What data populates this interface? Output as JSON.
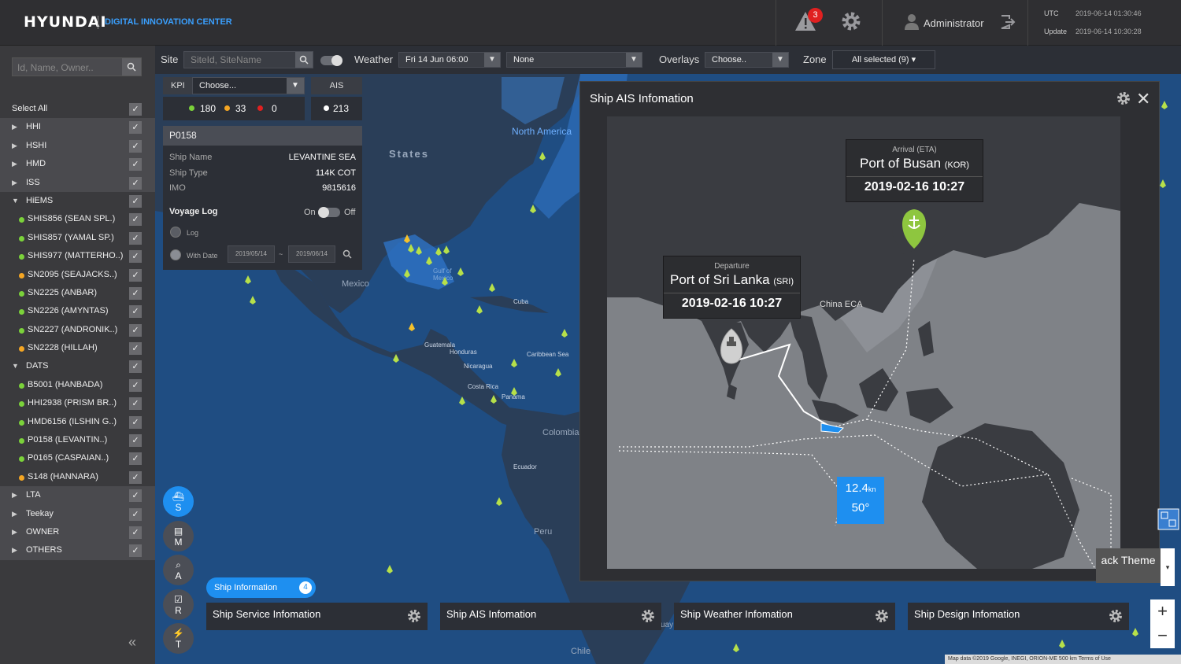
{
  "header": {
    "brand": "HYUNDAI",
    "subtitle": "DIGITAL INNOVATION CENTER",
    "alert_count": "3",
    "user": "Administrator",
    "utc_label": "UTC",
    "utc_value": "2019-06-14 01:30:46",
    "update_label": "Update",
    "update_value": "2019-06-14 10:30:28"
  },
  "sidebar": {
    "search_placeholder": "Id, Name, Owner..",
    "items": [
      {
        "label": "Select All",
        "type": "all"
      },
      {
        "label": "HHI",
        "type": "group"
      },
      {
        "label": "HSHI",
        "type": "group"
      },
      {
        "label": "HMD",
        "type": "group"
      },
      {
        "label": "ISS",
        "type": "group"
      },
      {
        "label": "HiEMS",
        "type": "group-open"
      },
      {
        "label": "SHIS856 (SEAN SPL.)",
        "type": "ship",
        "color": "#7bd23a"
      },
      {
        "label": "SHIS857 (YAMAL SP.)",
        "type": "ship",
        "color": "#7bd23a"
      },
      {
        "label": "SHIS977 (MATTERHO..)",
        "type": "ship",
        "color": "#7bd23a"
      },
      {
        "label": "SN2095 (SEAJACKS..)",
        "type": "ship",
        "color": "#f5a623"
      },
      {
        "label": "SN2225 (ANBAR)",
        "type": "ship",
        "color": "#7bd23a"
      },
      {
        "label": "SN2226 (AMYNTAS)",
        "type": "ship",
        "color": "#7bd23a"
      },
      {
        "label": "SN2227 (ANDRONIK..)",
        "type": "ship",
        "color": "#7bd23a"
      },
      {
        "label": "SN2228 (HILLAH)",
        "type": "ship",
        "color": "#f5a623"
      },
      {
        "label": "DATS",
        "type": "group-open"
      },
      {
        "label": "B5001 (HANBADA)",
        "type": "ship",
        "color": "#7bd23a"
      },
      {
        "label": "HHI2938 (PRISM BR..)",
        "type": "ship",
        "color": "#7bd23a"
      },
      {
        "label": "HMD6156 (ILSHIN G..)",
        "type": "ship",
        "color": "#7bd23a"
      },
      {
        "label": "P0158 (LEVANTIN..)",
        "type": "ship",
        "color": "#7bd23a"
      },
      {
        "label": "P0165 (CASPAIAN..)",
        "type": "ship",
        "color": "#7bd23a"
      },
      {
        "label": "S148 (HANNARA)",
        "type": "ship",
        "color": "#f5a623"
      },
      {
        "label": "LTA",
        "type": "group"
      },
      {
        "label": "Teekay",
        "type": "group"
      },
      {
        "label": "OWNER",
        "type": "group"
      },
      {
        "label": "OTHERS",
        "type": "group"
      }
    ]
  },
  "toolbar": {
    "site_label": "Site",
    "site_placeholder": "SiteId, SiteName",
    "weather_label": "Weather",
    "weather_date": "Fri 14 Jun 06:00",
    "weather_layer": "None",
    "overlays_label": "Overlays",
    "overlays_value": "Choose..",
    "zone_label": "Zone",
    "zone_value": "All selected (9)"
  },
  "kpi": {
    "label": "KPI",
    "select": "Choose...",
    "ais_label": "AIS",
    "green": "180",
    "yellow": "33",
    "red": "0",
    "ais_count": "213"
  },
  "ship_card": {
    "id": "P0158",
    "name_label": "Ship Name",
    "name": "LEVANTINE SEA",
    "type_label": "Ship Type",
    "type": "114K COT",
    "imo_label": "IMO",
    "imo": "9815616",
    "voyage_label": "Voyage Log",
    "on": "On",
    "off": "Off",
    "log": "Log",
    "with_date": "With Date",
    "date_from": "2019/05/14",
    "date_sep": "~",
    "date_to": "2019/06/14"
  },
  "map_labels": {
    "north_america": "North America",
    "states": "States",
    "mexico": "Mexico",
    "gulf": "Gulf of Mexico",
    "cuba": "Cuba",
    "guatemala": "Guatemala",
    "honduras": "Honduras",
    "nicaragua": "Nicaragua",
    "caribbean": "Caribbean Sea",
    "costa_rica": "Costa Rica",
    "panama": "Panama",
    "colombia": "Colombia",
    "ecuador": "Ecuador",
    "peru": "Peru",
    "chile": "Chile",
    "paraguay": "araguay"
  },
  "modal": {
    "title": "Ship AIS Infomation",
    "arrival_label": "Arrival (ETA)",
    "arrival_port": "Port of Busan",
    "arrival_code": "(KOR)",
    "arrival_date": "2019-02-16 10:27",
    "departure_label": "Departure",
    "departure_port": "Port of Sri Lanka",
    "departure_code": "(SRI)",
    "departure_date": "2019-02-16  10:27",
    "eca": "China ECA",
    "speed": "12.4",
    "speed_unit": "kn",
    "heading": "50°"
  },
  "tools": [
    {
      "letter": "S"
    },
    {
      "letter": "M"
    },
    {
      "letter": "A"
    },
    {
      "letter": "R"
    },
    {
      "letter": "T"
    }
  ],
  "bottom": {
    "pill": "Ship Information",
    "pill_count": "4",
    "panels": [
      "Ship Service Infomation",
      "Ship AIS Infomation",
      "Ship Weather Infomation",
      "Ship Design Infomation"
    ]
  },
  "theme": {
    "label": "ack Theme"
  },
  "attribution": "Map data ©2019 Google, INEGI, ORION-ME   500 km   Terms of Use",
  "colors": {
    "accent": "#1e8ff0",
    "green": "#7bd23a",
    "yellow": "#f5a623",
    "red": "#e02020"
  }
}
